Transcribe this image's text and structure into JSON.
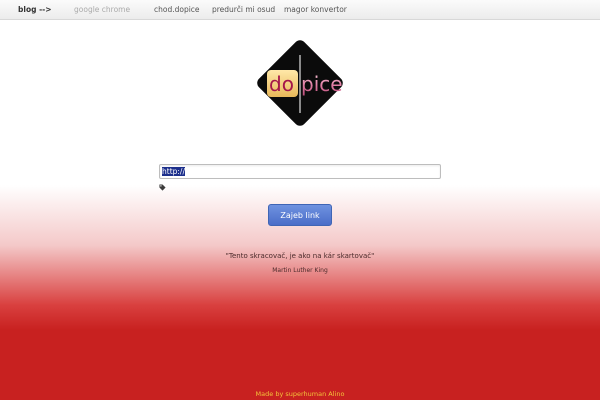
{
  "nav": {
    "brand": "blog -->",
    "items": [
      {
        "label": "google chrome",
        "muted": true
      },
      {
        "label": "chod.dopice"
      },
      {
        "label": "predurči mi osud"
      },
      {
        "label": "magor konvertor"
      }
    ]
  },
  "logo": {
    "text_left": "do",
    "text_right": "pice"
  },
  "form": {
    "url_value": "http://",
    "submit_label": "Zajeb link"
  },
  "quote": {
    "text": "\"Tento skracovač, je ako na kár skartovač\"",
    "author": "Martin Luther King"
  },
  "footer": {
    "text": "Made by superhuman Alino"
  },
  "colors": {
    "accent": "#5a7ed4",
    "red": "#c82120",
    "footer_text": "#f3c23a"
  },
  "icons": {
    "tag": "tag-icon"
  }
}
